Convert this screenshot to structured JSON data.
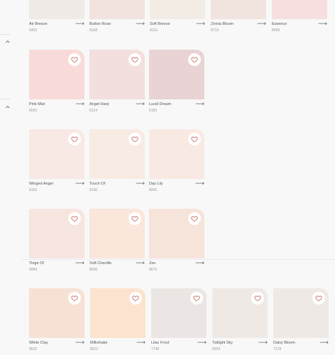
{
  "ui": {
    "collapse_icon": "chevron-up-icon",
    "favorite_icon": "heart-icon",
    "details_icon": "arrow-right-icon",
    "arrow_glyph": "⟶",
    "chevron_glyph": "^"
  },
  "rows": [
    {
      "cards": [
        {
          "name": "Air Breeze",
          "code": "9456",
          "color": "#f0ebe6",
          "heart": false
        },
        {
          "name": "Button Rose",
          "code": "8108",
          "color": "#f2e3df",
          "heart": false
        },
        {
          "name": "Soft Breeze",
          "code": "8116",
          "color": "#f2ece5",
          "heart": false
        },
        {
          "name": "Zinnia Bloom",
          "code": "8716",
          "color": "#f1e4df",
          "heart": false
        },
        {
          "name": "Essence",
          "code": "8099",
          "color": "#f7dfe0",
          "heart": false
        }
      ]
    },
    {
      "cards": [
        {
          "name": "Pink Mist",
          "code": "8092",
          "color": "#f8dbd9",
          "heart": true
        },
        {
          "name": "Angel Harp",
          "code": "8124",
          "color": "#f2dfde",
          "heart": true
        },
        {
          "name": "Lucid Dream",
          "code": "5182",
          "color": "#e9d3d5",
          "heart": true
        }
      ]
    },
    {
      "cards": [
        {
          "name": "Winged Angel",
          "code": "8100",
          "color": "#f8e9e4",
          "heart": true
        },
        {
          "name": "Touch Of",
          "code": "8140",
          "color": "#f7ebe4",
          "heart": true
        },
        {
          "name": "Day Lily",
          "code": "8060",
          "color": "#f8eae3",
          "heart": true
        }
      ]
    },
    {
      "cards": [
        {
          "name": "Tinge Of",
          "code": "8084",
          "color": "#f7e5e0",
          "heart": true
        },
        {
          "name": "Soft Chenille",
          "code": "8036",
          "color": "#fae6da",
          "heart": true
        },
        {
          "name": "Zen",
          "code": "8676",
          "color": "#f6e3da",
          "heart": true
        }
      ]
    },
    {
      "cards": [
        {
          "name": "White Clay",
          "code": "8620",
          "color": "#f7e1d4",
          "heart": true
        },
        {
          "name": "Milkshake",
          "code": "8012",
          "color": "#fbe3cf",
          "heart": true
        },
        {
          "name": "Lilac Frost",
          "code": "7748",
          "color": "#ebe6e3",
          "heart": true
        },
        {
          "name": "Twilight Sky",
          "code": "8204",
          "color": "#efe9e5",
          "heart": true
        },
        {
          "name": "Daisy Bloom",
          "code": "7178",
          "color": "#efe9e6",
          "heart": true
        }
      ]
    }
  ]
}
